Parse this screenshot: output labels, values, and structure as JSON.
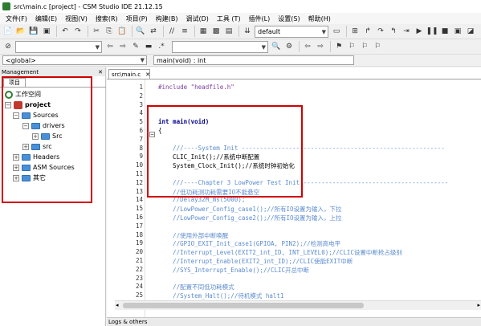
{
  "window": {
    "title": "src\\main.c [project] - CSM Studio IDE 21.12.15"
  },
  "menu": [
    "文件(F)",
    "编辑(E)",
    "视图(V)",
    "搜索(R)",
    "项目(P)",
    "构建(B)",
    "调试(D)",
    "工具 (T)",
    "插件(L)",
    "设置(S)",
    "帮助(H)"
  ],
  "toolbar": {
    "config_value": "default",
    "search_value": "",
    "scope_value": "<global>",
    "function_value": "main(void) : int"
  },
  "management": {
    "header": "Management",
    "tab": "项目",
    "tree": {
      "workspace": "工作空间",
      "project": "project",
      "sources": "Sources",
      "drivers": "drivers",
      "drivers_src": "Src",
      "src": "src",
      "headers": "Headers",
      "asm_sources": "ASM Sources",
      "other": "其它"
    }
  },
  "editor": {
    "tab": "src\\main.c",
    "line_numbers": [
      "1",
      "2",
      "3",
      "4",
      "5",
      "6",
      "7",
      "8",
      "9",
      "10",
      "11",
      "12",
      "13",
      "14",
      "15",
      "16",
      "17",
      "18",
      "19",
      "20",
      "21",
      "22",
      "23",
      "24",
      "25"
    ],
    "lines": [
      "#include \"headfile.h\"",
      "",
      "",
      "",
      "int main(void)",
      "{",
      "",
      "    ///----System Init --------------------------------------------------------",
      "    CLIC_Init();//系统中断配置",
      "    System_Clock_Init();//系统时钟初始化",
      "",
      "    ///----Chapter 3 LowPower Test Init ----------------------------------------",
      "    //低功耗测功耗需要IO不能悬空",
      "    //Delay32M_ms(5000);",
      "    //LowPower_Config_case1();//所有IO设置为输入，下拉",
      "    //LowPower_Config_case2();//所有IO设置为输入，上拉",
      "",
      "    //使用外部中断唤醒",
      "    //GPIO_EXIT_Init_case1(GPIOA, PIN2);//检测高电平",
      "    //Interrupt_Level(EXIT2_int_ID, INT_LEVEL0);//CLIC设置中断抢占级别",
      "    //Interrupt_Enable(EXIT2_int_ID);//CLIC使能EXIT中断",
      "    //SYS_Interrupt_Enable();//CLIC开总中断",
      "",
      "    //配置不同低功耗模式",
      "    //System_Halt();//待机模式 halt1"
    ]
  },
  "logs": {
    "label": "Logs & others"
  },
  "colors": {
    "highlight_box": "#d10000",
    "comment": "#5b8bd0",
    "keyword": "#00008b"
  }
}
